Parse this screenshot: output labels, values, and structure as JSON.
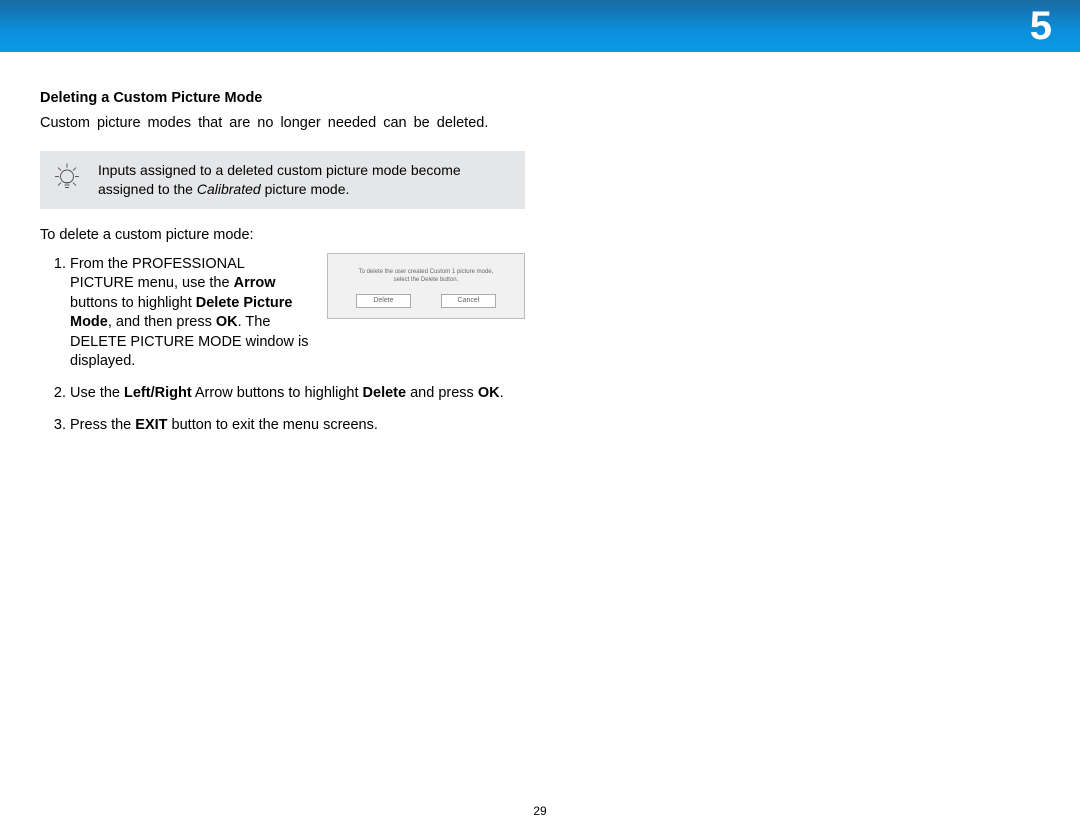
{
  "chapter": "5",
  "heading": "Deleting a Custom Picture Mode",
  "intro": "Custom picture modes that are no longer needed can be deleted.",
  "note_a": "Inputs assigned to a deleted custom picture mode become assigned to the ",
  "note_em": "Calibrated",
  "note_b": " picture mode.",
  "lead": "To delete a custom picture mode:",
  "step1": {
    "a": "From the PROFESSIONAL PICTURE menu, use the ",
    "arrow": "Arrow",
    "b": " buttons to highlight ",
    "dpm": "Delete Picture Mode",
    "c": ", and then press ",
    "ok": "OK",
    "d": ". The DELETE PICTURE MODE window is displayed."
  },
  "step2": {
    "a": "Use the ",
    "lr": "Left/Right",
    "b": " Arrow buttons to highlight ",
    "del": "Delete",
    "c": " and press ",
    "ok": "OK",
    "d": "."
  },
  "step3": {
    "a": "Press the ",
    "exit": "EXIT",
    "b": " button to exit the menu screens."
  },
  "dialog": {
    "msg1": "To delete the user created Custom 1 picture mode,",
    "msg2": "select the Delete button.",
    "delete": "Delete",
    "cancel": "Cancel"
  },
  "pagenum": "29"
}
